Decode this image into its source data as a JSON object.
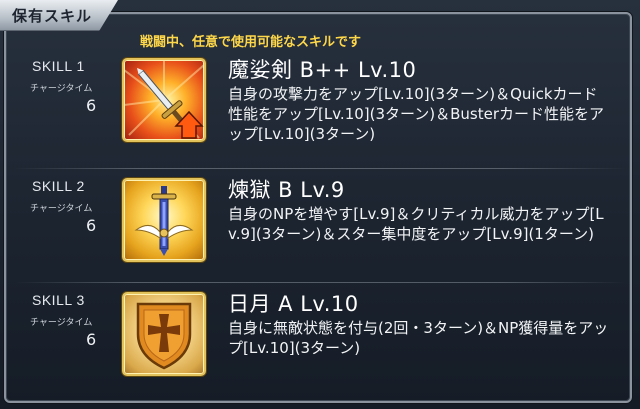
{
  "header": {
    "title": "保有スキル"
  },
  "subtitle": "戦闘中、任意で使用可能なスキルです",
  "charge_label": "チャージタイム",
  "skills": [
    {
      "label": "SKILL 1",
      "charge_time": "6",
      "name": "魔娑剣 B++ Lv.10",
      "description": "自身の攻撃力をアップ[Lv.10](3ターン)＆Quickカード性能をアップ[Lv.10](3ターン)＆Busterカード性能をアップ[Lv.10](3ターン)",
      "icon": "sword-attack-up-icon"
    },
    {
      "label": "SKILL 2",
      "charge_time": "6",
      "name": "煉獄 B Lv.9",
      "description": "自身のNPを増やす[Lv.9]＆クリティカル威力をアップ[Lv.9](3ターン)＆スター集中度をアップ[Lv.9](1ターン)",
      "icon": "sword-crest-icon"
    },
    {
      "label": "SKILL 3",
      "charge_time": "6",
      "name": "日月 A Lv.10",
      "description": "自身に無敵状態を付与(2回・3ターン)＆NP獲得量をアップ[Lv.10](3ターン)",
      "icon": "cross-shield-icon"
    }
  ],
  "colors": {
    "subtitle": "#ffd84a",
    "text": "#ffffff",
    "panel_border": "#8a939e"
  }
}
